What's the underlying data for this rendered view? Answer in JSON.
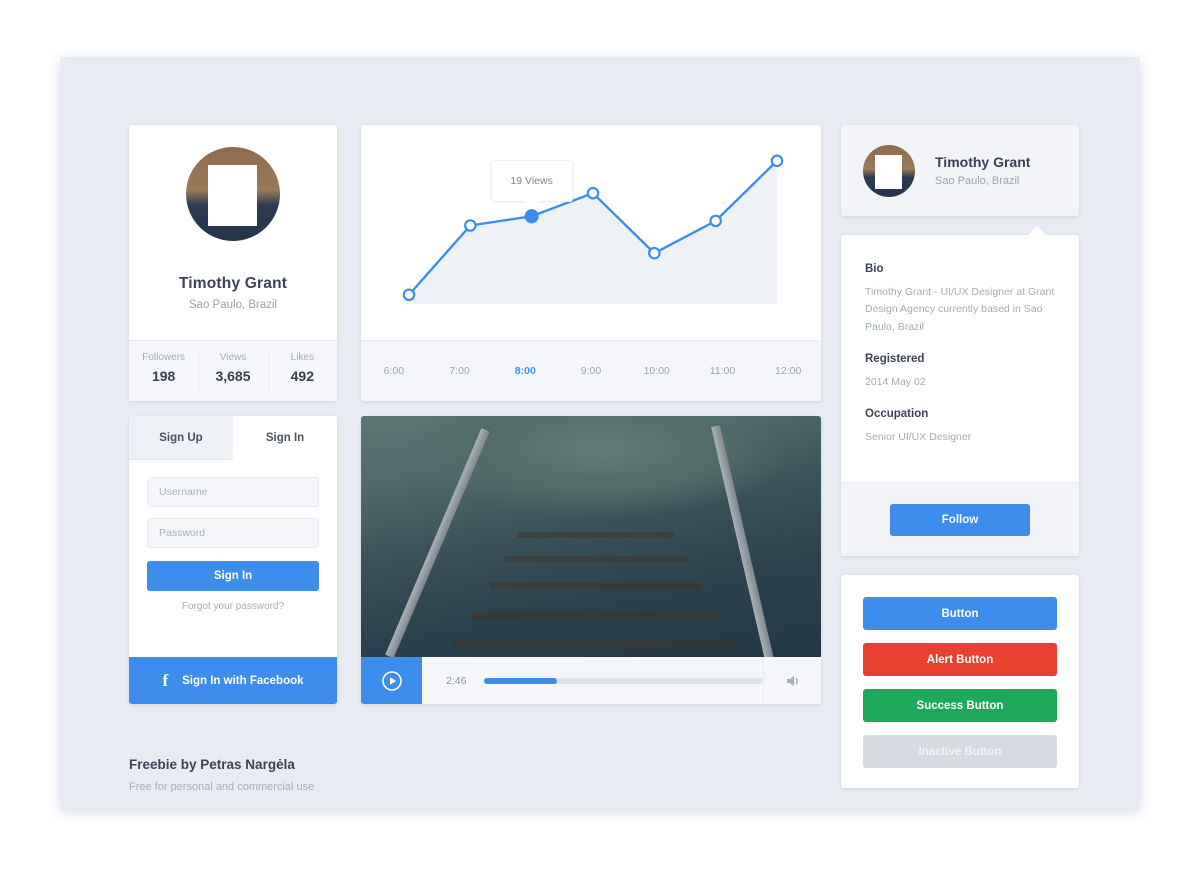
{
  "theme": {
    "accent": "#3d8ded",
    "alert": "#e8412f",
    "success": "#1fa85a",
    "inactive": "#d7dbe1",
    "canvas_bg": "#e8ebf2",
    "card_bg": "#ffffff",
    "muted_bg": "#f4f6fa",
    "text_dark": "#3b4354",
    "text_muted": "#9aa3b4"
  },
  "profile": {
    "name": "Timothy Grant",
    "location": "Sao Paulo, Brazil",
    "avatar_icon": "user-avatar-photo",
    "stats": [
      {
        "label": "Followers",
        "value": "198"
      },
      {
        "label": "Views",
        "value": "3,685"
      },
      {
        "label": "Likes",
        "value": "492"
      }
    ]
  },
  "login": {
    "tabs": [
      {
        "label": "Sign Up",
        "active": false
      },
      {
        "label": "Sign In",
        "active": true
      }
    ],
    "username_placeholder": "Username",
    "username_value": "",
    "password_placeholder": "Password",
    "password_value": "",
    "submit_label": "Sign In",
    "forgot_label": "Forgot your password?",
    "facebook_label": "Sign In with Facebook",
    "facebook_icon": "facebook-f-icon"
  },
  "chart_data": {
    "type": "line",
    "title": "",
    "xlabel": "",
    "ylabel": "Views",
    "categories": [
      "6:00",
      "7:00",
      "8:00",
      "9:00",
      "10:00",
      "11:00",
      "12:00"
    ],
    "values": [
      2,
      17,
      19,
      24,
      11,
      18,
      31
    ],
    "ylim": [
      0,
      34
    ],
    "grid": false,
    "legend": "none",
    "active_category": "8:00",
    "tooltip": {
      "label": "19 Views",
      "attached_to": "8:00"
    },
    "series": [
      {
        "name": "Views",
        "values": [
          2,
          17,
          19,
          24,
          11,
          18,
          31
        ]
      }
    ],
    "line_color": "#3d8ded",
    "area_fill": "#eef2f7"
  },
  "video": {
    "still_description": "railway-track-photo",
    "play_icon": "play-circle-icon",
    "time": "2:46",
    "progress_percent": 26,
    "volume_icon": "volume-icon"
  },
  "mini_profile": {
    "name": "Timothy Grant",
    "location": "Sao Paulo, Brazil",
    "avatar_icon": "user-avatar-photo"
  },
  "bio": {
    "heading_bio": "Bio",
    "text_bio": "Timothy Grant - UI/UX Designer at Grant Design Agency currently based in Sao Paulo, Brazil",
    "heading_registered": "Registered",
    "text_registered": "2014 May 02",
    "heading_occupation": "Occupation",
    "text_occupation": "Senior UI/UX Designer",
    "follow_label": "Follow"
  },
  "demo_buttons": [
    {
      "label": "Button",
      "color": "#3d8ded",
      "state": "default"
    },
    {
      "label": "Alert Button",
      "color": "#e8412f",
      "state": "alert"
    },
    {
      "label": "Success Button",
      "color": "#1fa85a",
      "state": "success"
    },
    {
      "label": "Inactive Button",
      "color": "#d7dbe1",
      "state": "inactive"
    }
  ],
  "footer": {
    "title": "Freebie by Petras Nargėla",
    "subtitle": "Free for personal and commercial use"
  }
}
